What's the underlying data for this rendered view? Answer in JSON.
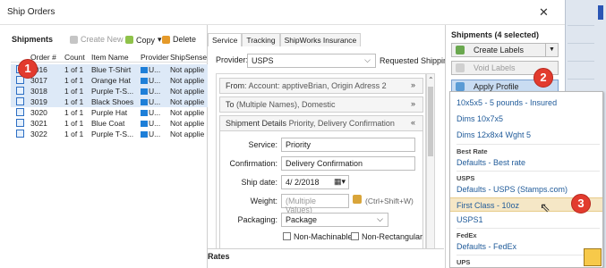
{
  "window": {
    "title": "Ship Orders",
    "close_glyph": "✕"
  },
  "left": {
    "header": "Shipments",
    "toolbar": {
      "create": "Create New",
      "copy": "Copy",
      "copy_caret": "▾",
      "delete": "Delete"
    },
    "columns": [
      "Order #",
      "Count",
      "Item Name",
      "Provider",
      "ShipSense"
    ],
    "rows": [
      {
        "order": "3016",
        "count": "1 of 1",
        "item": "Blue T-Shirt",
        "provider": "U...",
        "shipsense": "Not applie"
      },
      {
        "order": "3017",
        "count": "1 of 1",
        "item": "Orange Hat",
        "provider": "U...",
        "shipsense": "Not applie"
      },
      {
        "order": "3018",
        "count": "1 of 1",
        "item": "Purple T-S...",
        "provider": "U...",
        "shipsense": "Not applie"
      },
      {
        "order": "3019",
        "count": "1 of 1",
        "item": "Black Shoes",
        "provider": "U...",
        "shipsense": "Not applie"
      },
      {
        "order": "3020",
        "count": "1 of 1",
        "item": "Purple Hat",
        "provider": "U...",
        "shipsense": "Not applie"
      },
      {
        "order": "3021",
        "count": "1 of 1",
        "item": "Blue Coat",
        "provider": "U...",
        "shipsense": "Not applie"
      },
      {
        "order": "3022",
        "count": "1 of 1",
        "item": "Purple T-S...",
        "provider": "U...",
        "shipsense": "Not applie"
      }
    ]
  },
  "mid": {
    "tabs": [
      "Service",
      "Tracking",
      "ShipWorks Insurance"
    ],
    "provider_label": "Provider:",
    "provider_value": "USPS",
    "requested_label": "Requested Shipping",
    "from_label": "From",
    "from_value": "Account: apptiveBrian, Origin Adress 2",
    "to_label": "To",
    "to_value": "(Multiple Names), Domestic",
    "details_label": "Shipment Details",
    "details_value": "Priority, Delivery Confirmation",
    "service_label": "Service:",
    "service_value": "Priority",
    "confirmation_label": "Confirmation:",
    "confirmation_value": "Delivery Confirmation",
    "shipdate_label": "Ship date:",
    "shipdate_value": "4/ 2/2018",
    "weight_label": "Weight:",
    "weight_value": "(Multiple Values)",
    "weight_hint": "(Ctrl+Shift+W)",
    "packaging_label": "Packaging:",
    "packaging_value": "Package",
    "nonmachinable": "Non-Machinable",
    "nonrectangular": "Non-Rectangular",
    "rates_label": "Rates"
  },
  "right": {
    "header": "Shipments (4 selected)",
    "create_labels": "Create Labels",
    "void_labels": "Void Labels",
    "apply_profile": "Apply Profile"
  },
  "menu": {
    "items_top": [
      "10x5x5 - 5 pounds - Insured",
      "Dims 10x7x5",
      "Dims 12x8x4 Wght 5"
    ],
    "group_best": "Best Rate",
    "best_items": [
      "Defaults - Best rate"
    ],
    "group_usps": "USPS",
    "usps_items": [
      "Defaults - USPS (Stamps.com)",
      "First Class - 10oz",
      "USPS1"
    ],
    "group_fedex": "FedEx",
    "fedex_items": [
      "Defaults - FedEx"
    ],
    "group_ups": "UPS"
  },
  "callouts": [
    "1",
    "2",
    "3"
  ],
  "colors": {
    "badge": "#e23b2e",
    "selected_row": "#dde9f7",
    "menu_hover": "#f5e7c6",
    "link": "#1f5a99"
  }
}
